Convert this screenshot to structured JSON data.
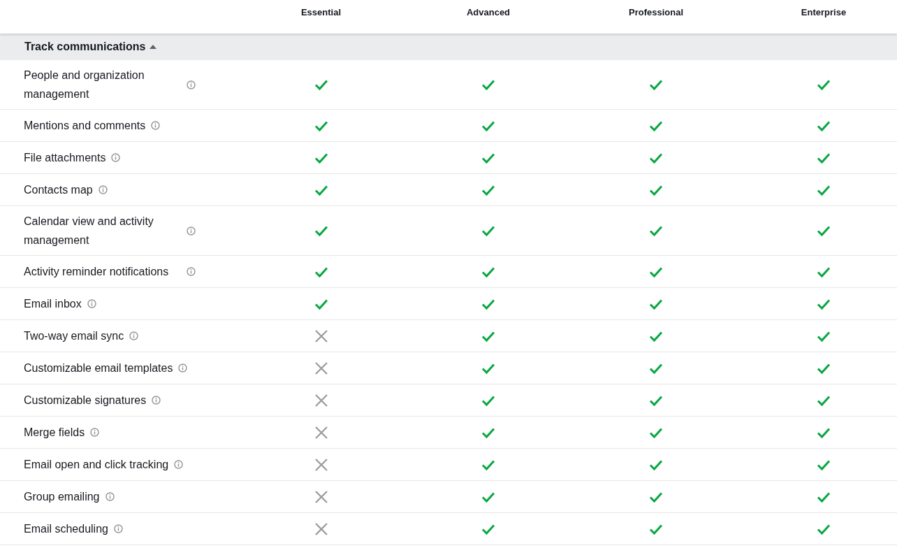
{
  "plans": [
    "Essential",
    "Advanced",
    "Professional",
    "Enterprise"
  ],
  "section": {
    "title": "Track communications",
    "expanded": true,
    "features": [
      {
        "name": "People and organization management",
        "included": [
          true,
          true,
          true,
          true
        ]
      },
      {
        "name": "Mentions and comments",
        "included": [
          true,
          true,
          true,
          true
        ]
      },
      {
        "name": "File attachments",
        "included": [
          true,
          true,
          true,
          true
        ]
      },
      {
        "name": "Contacts map",
        "included": [
          true,
          true,
          true,
          true
        ]
      },
      {
        "name": "Calendar view and activity management",
        "included": [
          true,
          true,
          true,
          true
        ]
      },
      {
        "name": "Activity reminder notifications",
        "included": [
          true,
          true,
          true,
          true
        ]
      },
      {
        "name": "Email inbox",
        "included": [
          true,
          true,
          true,
          true
        ]
      },
      {
        "name": "Two-way email sync",
        "included": [
          false,
          true,
          true,
          true
        ]
      },
      {
        "name": "Customizable email templates",
        "included": [
          false,
          true,
          true,
          true
        ]
      },
      {
        "name": "Customizable signatures",
        "included": [
          false,
          true,
          true,
          true
        ]
      },
      {
        "name": "Merge fields",
        "included": [
          false,
          true,
          true,
          true
        ]
      },
      {
        "name": "Email open and click tracking",
        "included": [
          false,
          true,
          true,
          true
        ]
      },
      {
        "name": "Group emailing",
        "included": [
          false,
          true,
          true,
          true
        ]
      },
      {
        "name": "Email scheduling",
        "included": [
          false,
          true,
          true,
          true
        ]
      }
    ]
  }
}
